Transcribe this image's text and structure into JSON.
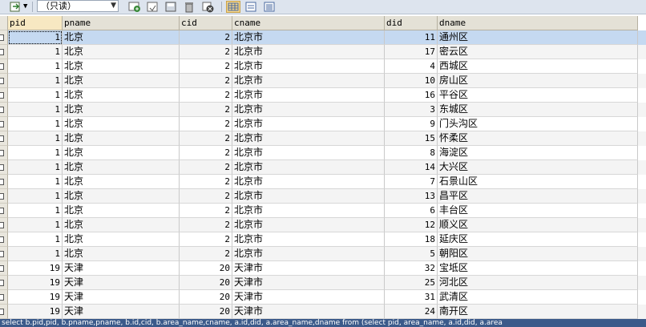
{
  "toolbar": {
    "mode_label": "（只读）",
    "icons": [
      "import-icon",
      "add-row-icon",
      "save-icon",
      "delete-icon",
      "cancel-icon",
      "grid-view-icon",
      "form-view-icon",
      "text-view-icon"
    ]
  },
  "columns": [
    "pid",
    "pname",
    "cid",
    "cname",
    "did",
    "dname"
  ],
  "rows": [
    [
      "1",
      "北京",
      "2",
      "北京市",
      "11",
      "通州区"
    ],
    [
      "1",
      "北京",
      "2",
      "北京市",
      "17",
      "密云区"
    ],
    [
      "1",
      "北京",
      "2",
      "北京市",
      "4",
      "西城区"
    ],
    [
      "1",
      "北京",
      "2",
      "北京市",
      "10",
      "房山区"
    ],
    [
      "1",
      "北京",
      "2",
      "北京市",
      "16",
      "平谷区"
    ],
    [
      "1",
      "北京",
      "2",
      "北京市",
      "3",
      "东城区"
    ],
    [
      "1",
      "北京",
      "2",
      "北京市",
      "9",
      "门头沟区"
    ],
    [
      "1",
      "北京",
      "2",
      "北京市",
      "15",
      "怀柔区"
    ],
    [
      "1",
      "北京",
      "2",
      "北京市",
      "8",
      "海淀区"
    ],
    [
      "1",
      "北京",
      "2",
      "北京市",
      "14",
      "大兴区"
    ],
    [
      "1",
      "北京",
      "2",
      "北京市",
      "7",
      "石景山区"
    ],
    [
      "1",
      "北京",
      "2",
      "北京市",
      "13",
      "昌平区"
    ],
    [
      "1",
      "北京",
      "2",
      "北京市",
      "6",
      "丰台区"
    ],
    [
      "1",
      "北京",
      "2",
      "北京市",
      "12",
      "顺义区"
    ],
    [
      "1",
      "北京",
      "2",
      "北京市",
      "18",
      "延庆区"
    ],
    [
      "1",
      "北京",
      "2",
      "北京市",
      "5",
      "朝阳区"
    ],
    [
      "19",
      "天津",
      "20",
      "天津市",
      "32",
      "宝坻区"
    ],
    [
      "19",
      "天津",
      "20",
      "天津市",
      "25",
      "河北区"
    ],
    [
      "19",
      "天津",
      "20",
      "天津市",
      "31",
      "武清区"
    ],
    [
      "19",
      "天津",
      "20",
      "天津市",
      "24",
      "南开区"
    ]
  ],
  "status_sql": "select b.pid,pid, b.pname,pname, b.id,cid, b.area_name,cname, a.id,did, a.area_name,dname from (select pid, area_name, a.id,did, a.area"
}
